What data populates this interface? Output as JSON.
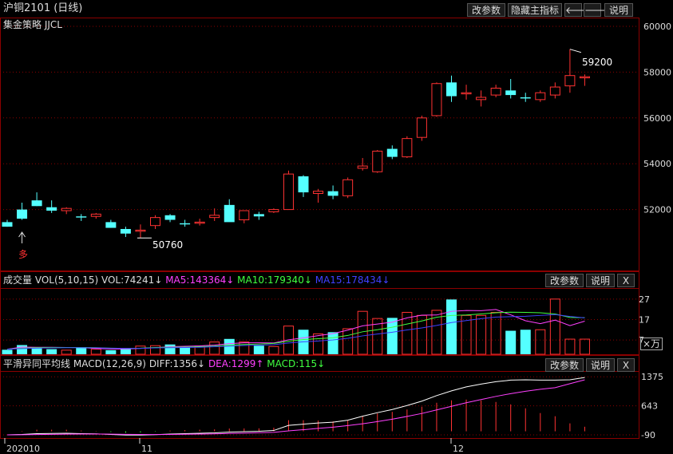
{
  "header": {
    "title": "沪铜2101 (日线)",
    "buttons": {
      "params": "改参数",
      "hide_indicator": "隐藏主指标",
      "explain": "说明"
    },
    "nav_icons": [
      "arrow-left-icon",
      "arrow-right-icon"
    ]
  },
  "main_panel": {
    "indicator_label": "集金策略 JJCL",
    "price_axis": [
      "60000",
      "58000",
      "56000",
      "54000",
      "52000"
    ],
    "annotation_high": "59200",
    "annotation_low": "50760",
    "signal_label": "多"
  },
  "volume_panel": {
    "title": "成交量",
    "indicator": "VOL(5,10,15)",
    "vol_value": "VOL:74241↓",
    "ma5": "MA5:143364↓",
    "ma10": "MA10:179340↓",
    "ma15": "MA15:178434↓",
    "axis": [
      "27",
      "17",
      "7"
    ],
    "unit_label": "×万",
    "buttons": {
      "params": "改参数",
      "explain": "说明",
      "close": "X"
    }
  },
  "macd_panel": {
    "title": "平滑异同平均线",
    "indicator": "MACD(12,26,9)",
    "diff": "DIFF:1356↓",
    "dea": "DEA:1299↑",
    "macd": "MACD:115↓",
    "axis": [
      "1375",
      "643",
      "-90"
    ],
    "buttons": {
      "params": "改参数",
      "explain": "说明",
      "close": "X"
    }
  },
  "x_axis": {
    "labels": [
      "202010",
      "11",
      "12"
    ]
  },
  "colors": {
    "up": "#ff3232",
    "down": "#54ffff",
    "bg": "#000000",
    "ma5": "#ff40ff",
    "ma10": "#40ff40",
    "ma15": "#4040ff",
    "diff": "#ffffff",
    "dea": "#ff40ff",
    "macd_text": "#40ff40",
    "grid": "#8b0000"
  },
  "chart_data": {
    "type": "candlestick",
    "ylim": [
      50000,
      60000
    ],
    "candles": [
      {
        "o": 51450,
        "h": 51550,
        "l": 51250,
        "c": 51250
      },
      {
        "o": 52000,
        "h": 52300,
        "l": 51550,
        "c": 51600
      },
      {
        "o": 52400,
        "h": 52750,
        "l": 52150,
        "c": 52150
      },
      {
        "o": 52100,
        "h": 52400,
        "l": 51850,
        "c": 51950
      },
      {
        "o": 51950,
        "h": 52100,
        "l": 51800,
        "c": 52050
      },
      {
        "o": 51700,
        "h": 51800,
        "l": 51500,
        "c": 51650
      },
      {
        "o": 51700,
        "h": 51850,
        "l": 51600,
        "c": 51800
      },
      {
        "o": 51450,
        "h": 51550,
        "l": 51200,
        "c": 51200
      },
      {
        "o": 51150,
        "h": 51250,
        "l": 50800,
        "c": 50950
      },
      {
        "o": 51050,
        "h": 51350,
        "l": 50760,
        "c": 51100
      },
      {
        "o": 51300,
        "h": 51750,
        "l": 51150,
        "c": 51650
      },
      {
        "o": 51750,
        "h": 51800,
        "l": 51450,
        "c": 51550
      },
      {
        "o": 51400,
        "h": 51550,
        "l": 51250,
        "c": 51350
      },
      {
        "o": 51400,
        "h": 51600,
        "l": 51300,
        "c": 51450
      },
      {
        "o": 51650,
        "h": 52050,
        "l": 51500,
        "c": 51750
      },
      {
        "o": 52200,
        "h": 52450,
        "l": 51800,
        "c": 51450
      },
      {
        "o": 51550,
        "h": 51950,
        "l": 51400,
        "c": 51950
      },
      {
        "o": 51800,
        "h": 51900,
        "l": 51550,
        "c": 51700
      },
      {
        "o": 51900,
        "h": 52050,
        "l": 51850,
        "c": 52000
      },
      {
        "o": 52000,
        "h": 53700,
        "l": 52000,
        "c": 53550
      },
      {
        "o": 53450,
        "h": 53500,
        "l": 52550,
        "c": 52750
      },
      {
        "o": 52700,
        "h": 52900,
        "l": 52300,
        "c": 52800
      },
      {
        "o": 52800,
        "h": 53050,
        "l": 52450,
        "c": 52600
      },
      {
        "o": 52600,
        "h": 53400,
        "l": 52500,
        "c": 53300
      },
      {
        "o": 53800,
        "h": 54250,
        "l": 53700,
        "c": 53900
      },
      {
        "o": 53650,
        "h": 54600,
        "l": 53600,
        "c": 54550
      },
      {
        "o": 54650,
        "h": 54800,
        "l": 54200,
        "c": 54300
      },
      {
        "o": 54300,
        "h": 55200,
        "l": 54250,
        "c": 55100
      },
      {
        "o": 55150,
        "h": 56100,
        "l": 55000,
        "c": 56000
      },
      {
        "o": 56100,
        "h": 57550,
        "l": 56050,
        "c": 57500
      },
      {
        "o": 57550,
        "h": 57850,
        "l": 56700,
        "c": 56950
      },
      {
        "o": 57050,
        "h": 57450,
        "l": 56800,
        "c": 57100
      },
      {
        "o": 56800,
        "h": 57200,
        "l": 56500,
        "c": 56900
      },
      {
        "o": 57000,
        "h": 57450,
        "l": 56900,
        "c": 57300
      },
      {
        "o": 57200,
        "h": 57700,
        "l": 56850,
        "c": 57000
      },
      {
        "o": 56900,
        "h": 57100,
        "l": 56700,
        "c": 56850
      },
      {
        "o": 56800,
        "h": 57200,
        "l": 56700,
        "c": 57100
      },
      {
        "o": 57000,
        "h": 57550,
        "l": 56850,
        "c": 57350
      },
      {
        "o": 57400,
        "h": 59000,
        "l": 57100,
        "c": 57850
      },
      {
        "o": 57750,
        "h": 57900,
        "l": 57400,
        "c": 57800
      }
    ],
    "volume": {
      "ylim": [
        0,
        32
      ],
      "values": [
        2.2,
        4.5,
        3.5,
        2.5,
        2.0,
        3.5,
        2.5,
        2.0,
        2.5,
        4.0,
        4.2,
        4.8,
        3.5,
        4.0,
        6.0,
        7.5,
        6.0,
        4.2,
        3.8,
        13.8,
        12.0,
        10.0,
        10.8,
        12.5,
        21.0,
        17.5,
        17.8,
        20.5,
        19.0,
        21.5,
        26.8,
        19.0,
        19.0,
        20.5,
        11.5,
        12.0,
        12.0,
        27.0,
        7.4,
        7.4
      ],
      "ma5": [
        2.5,
        3.5,
        3.4,
        3.4,
        3.3,
        3.3,
        2.8,
        2.6,
        2.6,
        2.9,
        3.2,
        3.7,
        3.9,
        4.1,
        4.5,
        5.2,
        5.6,
        5.6,
        5.5,
        7.1,
        8.0,
        9.1,
        10.1,
        11.8,
        13.9,
        14.8,
        15.7,
        17.8,
        19.1,
        19.2,
        21.0,
        21.4,
        21.3,
        21.9,
        19.3,
        16.4,
        15.0,
        16.7,
        14.0,
        16.2
      ],
      "ma10": [
        2.5,
        3.0,
        3.2,
        3.3,
        3.3,
        3.3,
        3.2,
        3.0,
        2.9,
        3.0,
        3.3,
        3.4,
        3.5,
        3.7,
        4.0,
        4.5,
        4.8,
        5.0,
        5.3,
        6.4,
        7.2,
        7.6,
        8.1,
        9.2,
        11.0,
        12.0,
        13.2,
        14.8,
        16.3,
        18.1,
        19.0,
        19.2,
        19.7,
        20.3,
        20.6,
        20.5,
        20.3,
        19.7,
        18.0,
        17.9
      ],
      "ma15": [
        2.5,
        2.8,
        3.0,
        3.1,
        3.2,
        3.2,
        3.1,
        3.0,
        2.9,
        2.9,
        3.1,
        3.2,
        3.3,
        3.4,
        3.7,
        4.0,
        4.3,
        4.5,
        4.7,
        5.5,
        6.1,
        6.5,
        7.0,
        7.8,
        9.0,
        9.9,
        10.8,
        11.9,
        12.9,
        14.1,
        15.5,
        16.5,
        17.4,
        18.2,
        18.4,
        18.6,
        19.0,
        19.4,
        18.5,
        17.8
      ]
    },
    "macd": {
      "ylim": [
        -150,
        1500
      ],
      "diff": [
        -90,
        -80,
        -60,
        -55,
        -50,
        -60,
        -65,
        -80,
        -95,
        -95,
        -85,
        -70,
        -60,
        -50,
        -40,
        -20,
        -10,
        0,
        20,
        150,
        180,
        210,
        230,
        280,
        380,
        470,
        550,
        650,
        760,
        900,
        1020,
        1120,
        1190,
        1250,
        1290,
        1300,
        1290,
        1290,
        1300,
        1356
      ],
      "dea": [
        -90,
        -88,
        -82,
        -77,
        -72,
        -70,
        -69,
        -71,
        -76,
        -80,
        -81,
        -79,
        -75,
        -70,
        -64,
        -55,
        -46,
        -37,
        -26,
        10,
        40,
        75,
        105,
        145,
        190,
        245,
        305,
        375,
        450,
        540,
        630,
        720,
        800,
        880,
        950,
        1010,
        1060,
        1100,
        1200,
        1299
      ],
      "bars": [
        0,
        10,
        40,
        40,
        40,
        20,
        8,
        -18,
        -38,
        -30,
        -8,
        18,
        30,
        40,
        48,
        70,
        72,
        74,
        92,
        280,
        280,
        270,
        250,
        270,
        380,
        450,
        490,
        550,
        620,
        720,
        780,
        800,
        780,
        740,
        680,
        580,
        460,
        380,
        200,
        115
      ]
    }
  }
}
